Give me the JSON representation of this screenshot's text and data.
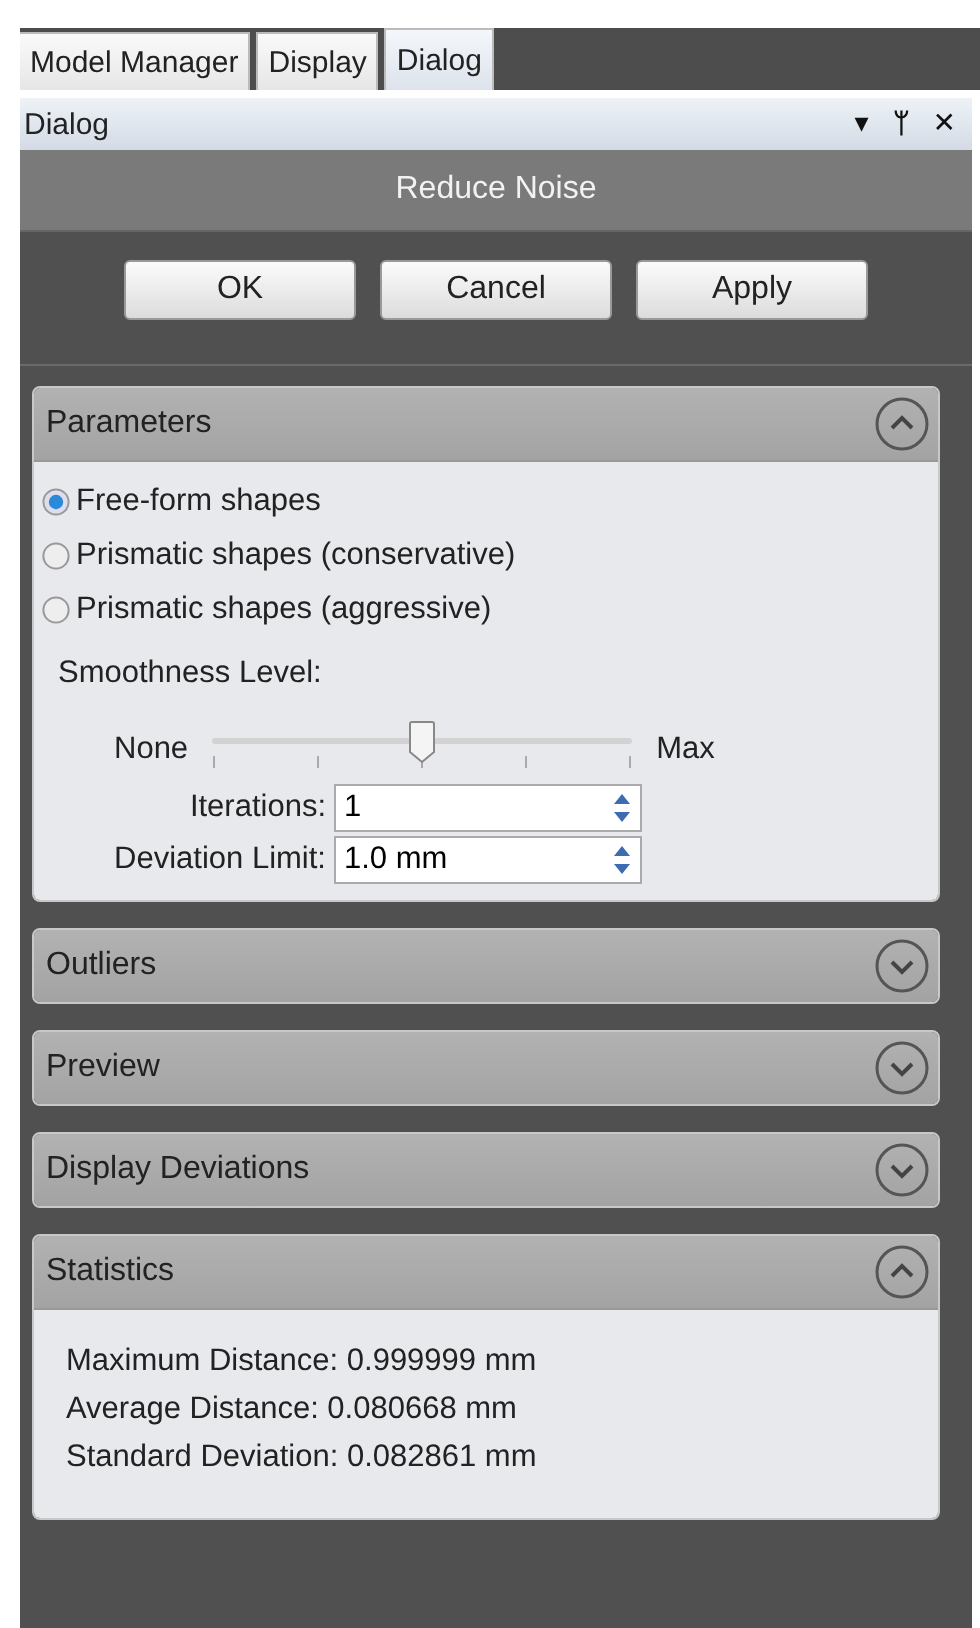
{
  "tabs": [
    {
      "label": "Model Manager",
      "selected": false
    },
    {
      "label": "Display",
      "selected": false
    },
    {
      "label": "Dialog",
      "selected": true
    }
  ],
  "pane": {
    "title": "Dialog",
    "menu_glyph": "▾",
    "pin_glyph": "ᛘ",
    "close_glyph": "✕"
  },
  "dialog": {
    "title": "Reduce Noise",
    "buttons": [
      "OK",
      "Cancel",
      "Apply"
    ]
  },
  "sections": [
    {
      "title": "Parameters",
      "expanded": true,
      "options": [
        {
          "label": "Free-form shapes",
          "selected": true
        },
        {
          "label": "Prismatic shapes (conservative)",
          "selected": false
        },
        {
          "label": "Prismatic shapes (aggressive)",
          "selected": false
        }
      ],
      "slider": {
        "label": "Smoothness Level:",
        "min_label": "None",
        "max_label": "Max",
        "level": 0.5
      },
      "fields": [
        {
          "label": "Iterations:",
          "value": "1"
        },
        {
          "label": "Deviation Limit:",
          "value": "1.0 mm"
        }
      ]
    },
    {
      "title": "Outliers",
      "expanded": false
    },
    {
      "title": "Preview",
      "expanded": false
    },
    {
      "title": "Display Deviations",
      "expanded": false
    },
    {
      "title": "Statistics",
      "expanded": true,
      "lines": [
        "Maximum Distance: 0.999999 mm",
        "Average Distance: 0.080668 mm",
        "Standard Deviation: 0.082861 mm"
      ]
    }
  ]
}
